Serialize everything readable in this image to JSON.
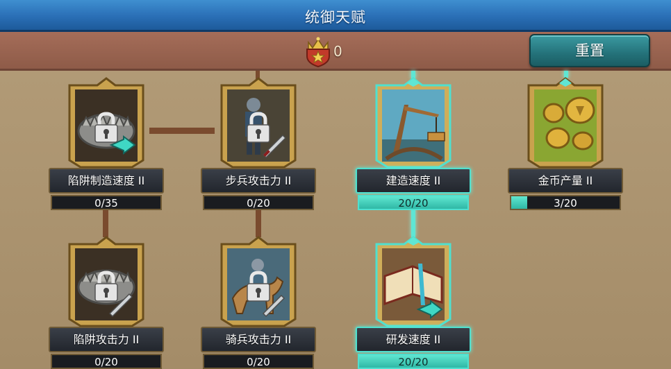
{
  "header": {
    "title": "统御天赋"
  },
  "points": {
    "value": "0",
    "icon": "crown-star-icon"
  },
  "reset_button": {
    "label": "重置"
  },
  "colors": {
    "active": "#5fe6d4",
    "locked_connector": "#7a4b2e",
    "title_bar": "#2a6fb6"
  },
  "talents": [
    {
      "id": "trap-build-speed",
      "name": "陷阱制造速度 II",
      "progress": "0/35",
      "fill": 0.0,
      "locked": true,
      "active": false,
      "icon": "bear-trap-icon"
    },
    {
      "id": "infantry-attack",
      "name": "步兵攻击力 II",
      "progress": "0/20",
      "fill": 0.0,
      "locked": true,
      "active": false,
      "icon": "infantry-soldier-icon"
    },
    {
      "id": "build-speed",
      "name": "建造速度 II",
      "progress": "20/20",
      "fill": 1.0,
      "locked": false,
      "active": true,
      "icon": "construction-crane-icon"
    },
    {
      "id": "gold-output",
      "name": "金币产量 II",
      "progress": "3/20",
      "fill": 0.15,
      "locked": false,
      "active": false,
      "icon": "gold-coins-icon"
    },
    {
      "id": "trap-attack",
      "name": "陷阱攻击力 II",
      "progress": "0/20",
      "fill": 0.0,
      "locked": true,
      "active": false,
      "icon": "bear-trap-sword-icon"
    },
    {
      "id": "cavalry-attack",
      "name": "骑兵攻击力 II",
      "progress": "0/20",
      "fill": 0.0,
      "locked": true,
      "active": false,
      "icon": "cavalry-rider-icon"
    },
    {
      "id": "research-speed",
      "name": "研发速度 II",
      "progress": "20/20",
      "fill": 1.0,
      "locked": false,
      "active": true,
      "icon": "open-book-icon"
    }
  ]
}
